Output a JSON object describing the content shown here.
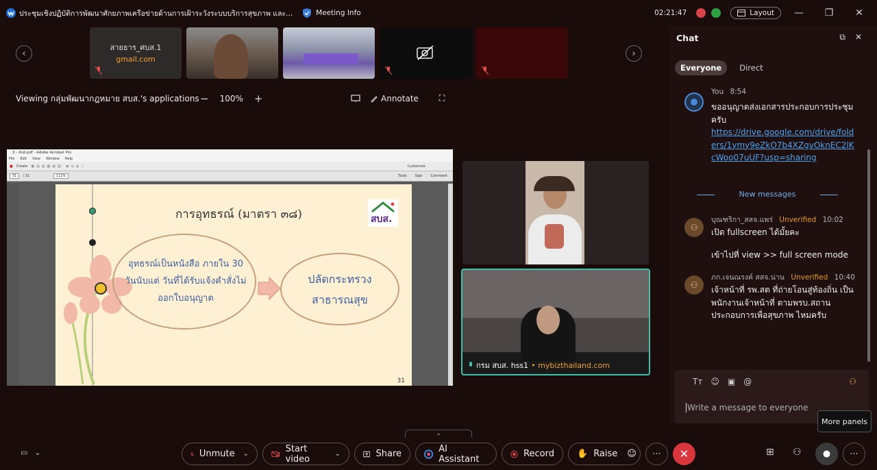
{
  "titlebar": {
    "title": "ประชุมเชิงปฏิบัติการพัฒนาศักยภาพเครือข่ายด้านการเฝ้าระวังระบบบริการสุขภาพ และ...",
    "meeting_info": "Meeting Info",
    "time": "02:21:47",
    "layout": "Layout"
  },
  "participants": [
    {
      "name": "สายธาร_ศบส.1",
      "sub": "gmail.com"
    },
    {
      "name": "",
      "sub": ""
    },
    {
      "name": "",
      "sub": ""
    },
    {
      "name": "",
      "sub": ""
    },
    {
      "name": "",
      "sub": ""
    }
  ],
  "share": {
    "viewing": "Viewing กลุ่มพัฒนากฎหมาย สบส.'s applications",
    "zoom": "100%",
    "annotate": "Annotate"
  },
  "pdf": {
    "window_title": "3 - สบส.pdf - Adobe Acrobat Pro",
    "menu": [
      "File",
      "Edit",
      "View",
      "Window",
      "Help"
    ],
    "create": "Create",
    "customize": "Customize",
    "page": "31",
    "pages": "/ 31",
    "zoom": "112%",
    "panels": [
      "Tools",
      "Sign",
      "Comment"
    ]
  },
  "slide": {
    "title": "การอุทธรณ์ (มาตรา ๓๘)",
    "left_text": "อุทธรณ์เป็นหนังสือ ภายใน 30 วันนับแต่ วันที่ได้รับแจ้งคำสั่งไม่ ออกใบอนุญาต",
    "right_text": "ปลัดกระทรวง สาธารณสุข",
    "logo": "สบส.",
    "page_number": "31"
  },
  "video": {
    "active_name": "กรม สบส. hss1",
    "active_site": "• mybizthailand.com"
  },
  "chat": {
    "title": "Chat",
    "tabs": {
      "everyone": "Everyone",
      "direct": "Direct"
    },
    "new_messages": "New messages",
    "messages": [
      {
        "sender": "You",
        "time": "8:54",
        "body": "ขออนุญาตส่งเอกสารประกอบการประชุมครับ",
        "link": "https://drive.google.com/drive/folders/1ymy9eZkO7b4XZgvOknEC2lKcWoo07uUF?usp=sharing"
      },
      {
        "sender": "บุณฑริกา_สสจ.แพร่",
        "status": "Unverified",
        "time": "10:02",
        "body": "เปิด fullscreen ได้มั้ยคะ",
        "body2": "เข้าไปที่ view >> full screen mode"
      },
      {
        "sender": "ภก.เจนณรงค์ สสจ.น่าน",
        "status": "Unverified",
        "time": "10:40",
        "body": "เจ้าหน้าที่ รพ.สต ที่ถ่ายโอนสู่ท้องถิ่น เป็นพนักงานเจ้าหน้าที่ ตามพรบ.สถานประกอบการเพื่อสุขภาพ ไหมครับ"
      }
    ],
    "placeholder": "Write a message to everyone"
  },
  "tooltip": "More panels",
  "controls": {
    "unmute": "Unmute",
    "start_video": "Start video",
    "share": "Share",
    "ai_assistant": "AI Assistant",
    "record": "Record",
    "raise": "Raise"
  }
}
